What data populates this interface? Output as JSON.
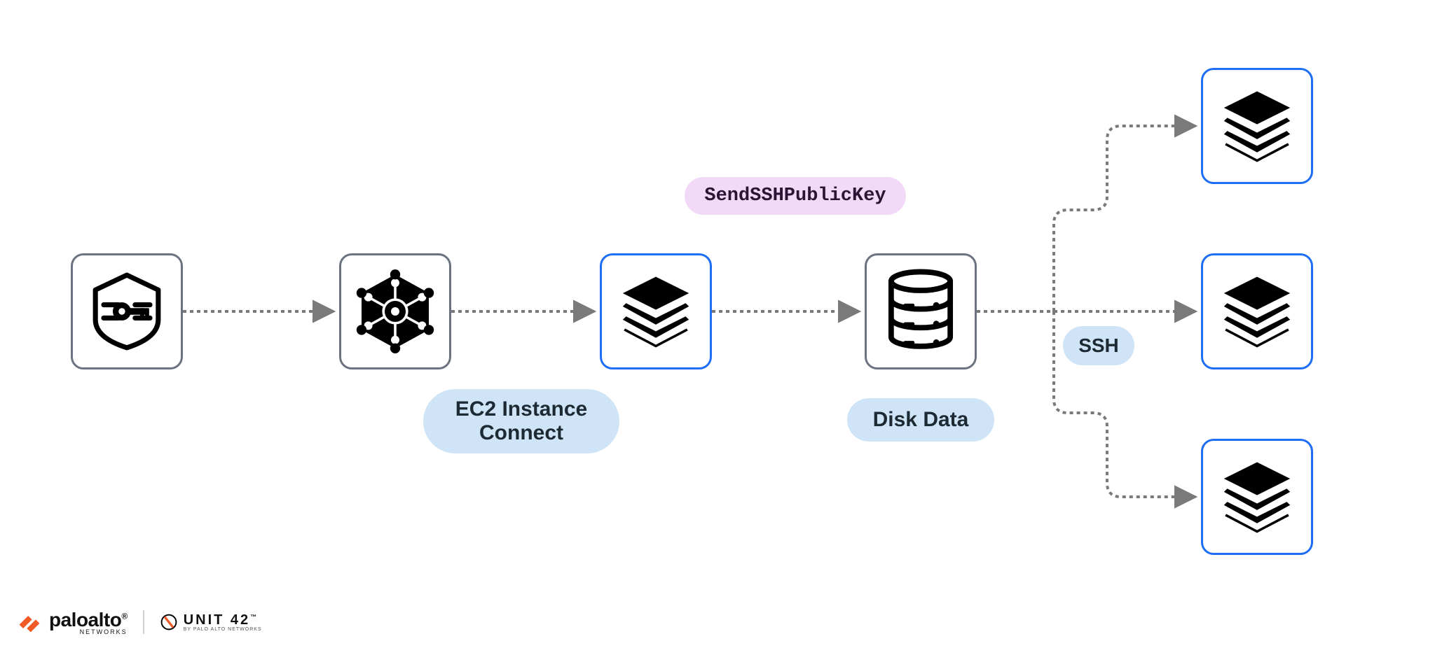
{
  "labels": {
    "sendssh": "SendSSHPublicKey",
    "ec2ic_line1": "EC2 Instance",
    "ec2ic_line2": "Connect",
    "diskdata": "Disk Data",
    "ssh": "SSH"
  },
  "nodes": {
    "key": {
      "name": "key-node",
      "border": "gray",
      "icon": "key-shield"
    },
    "network": {
      "name": "network-node",
      "border": "gray",
      "icon": "hex-network"
    },
    "stack1": {
      "name": "stack-node-ec2",
      "border": "blue",
      "icon": "layer-stack"
    },
    "database": {
      "name": "database-node",
      "border": "gray",
      "icon": "database"
    },
    "targetA": {
      "name": "target-stack-a",
      "border": "blue",
      "icon": "layer-stack"
    },
    "targetB": {
      "name": "target-stack-b",
      "border": "blue",
      "icon": "layer-stack"
    },
    "targetC": {
      "name": "target-stack-c",
      "border": "blue",
      "icon": "layer-stack"
    }
  },
  "edges": [
    {
      "from": "key",
      "to": "network",
      "style": "straight"
    },
    {
      "from": "network",
      "to": "stack1",
      "style": "straight"
    },
    {
      "from": "stack1",
      "to": "database",
      "style": "straight",
      "label_ref": "sendssh"
    },
    {
      "from": "database",
      "to": "targetA",
      "style": "branch-up",
      "label_ref": "ssh"
    },
    {
      "from": "database",
      "to": "targetB",
      "style": "straight",
      "label_ref": "ssh"
    },
    {
      "from": "database",
      "to": "targetC",
      "style": "branch-down",
      "label_ref": "ssh"
    }
  ],
  "footer": {
    "brand1_main": "paloalto",
    "brand1_sub": "NETWORKS",
    "brand2_main": "UNIT 42",
    "brand2_sub": "BY PALO ALTO NETWORKS"
  },
  "colors": {
    "node_gray": "#6b7280",
    "node_blue": "#1d6df5",
    "pill_blue": "#cfe4f7",
    "pill_violet": "#f1d9f7",
    "arrow": "#7a7a7a",
    "brand_orange": "#f15a24"
  }
}
